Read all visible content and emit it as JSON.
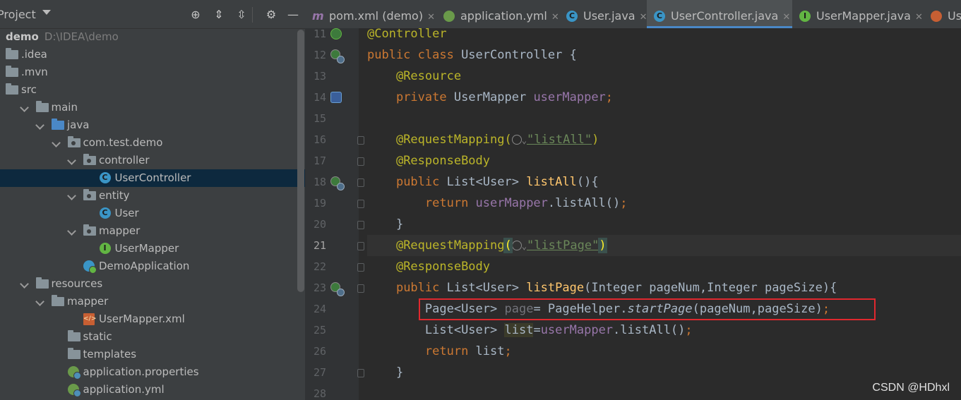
{
  "project_panel": {
    "title": "Project",
    "toolbar_icons": [
      "locate-icon",
      "expand-all-icon",
      "collapse-all-icon",
      "gear-icon",
      "minimize-icon"
    ],
    "tree": [
      {
        "label": "demo",
        "path": "D:\\IDEA\\demo",
        "indent": 0,
        "arrow": "none",
        "icon": "none",
        "bold": true
      },
      {
        "label": ".idea",
        "indent": 0,
        "arrow": "none",
        "icon": "folder"
      },
      {
        "label": ".mvn",
        "indent": 0,
        "arrow": "none",
        "icon": "folder"
      },
      {
        "label": "src",
        "indent": 0,
        "arrow": "none",
        "icon": "folder"
      },
      {
        "label": "main",
        "indent": 1,
        "arrow": "down",
        "icon": "folder"
      },
      {
        "label": "java",
        "indent": 2,
        "arrow": "down",
        "icon": "folder-blue"
      },
      {
        "label": "com.test.demo",
        "indent": 3,
        "arrow": "down",
        "icon": "package"
      },
      {
        "label": "controller",
        "indent": 4,
        "arrow": "down",
        "icon": "package"
      },
      {
        "label": "UserController",
        "indent": 5,
        "arrow": "none",
        "icon": "class",
        "selected": true
      },
      {
        "label": "entity",
        "indent": 4,
        "arrow": "down",
        "icon": "package"
      },
      {
        "label": "User",
        "indent": 5,
        "arrow": "none",
        "icon": "class"
      },
      {
        "label": "mapper",
        "indent": 4,
        "arrow": "down",
        "icon": "package"
      },
      {
        "label": "UserMapper",
        "indent": 5,
        "arrow": "none",
        "icon": "interface"
      },
      {
        "label": "DemoApplication",
        "indent": 4,
        "arrow": "none",
        "icon": "app"
      },
      {
        "label": "resources",
        "indent": 1,
        "arrow": "down",
        "icon": "folder"
      },
      {
        "label": "mapper",
        "indent": 2,
        "arrow": "down",
        "icon": "folder"
      },
      {
        "label": "UserMapper.xml",
        "indent": 4,
        "arrow": "none",
        "icon": "xml"
      },
      {
        "label": "static",
        "indent": 3,
        "arrow": "none",
        "icon": "folder"
      },
      {
        "label": "templates",
        "indent": 3,
        "arrow": "none",
        "icon": "folder"
      },
      {
        "label": "application.properties",
        "indent": 3,
        "arrow": "none",
        "icon": "spring"
      },
      {
        "label": "application.yml",
        "indent": 3,
        "arrow": "none",
        "icon": "spring"
      }
    ]
  },
  "tabs": [
    {
      "label": "pom.xml (demo)",
      "icon": "maven-icon",
      "closable": true
    },
    {
      "label": "application.yml",
      "icon": "spring-config-icon",
      "closable": true
    },
    {
      "label": "User.java",
      "icon": "class-icon",
      "closable": true
    },
    {
      "label": "UserController.java",
      "icon": "class-icon",
      "closable": true,
      "active": true
    },
    {
      "label": "UserMapper.java",
      "icon": "interface-icon",
      "closable": true
    },
    {
      "label": "Us",
      "icon": "xml-icon",
      "closable": false
    }
  ],
  "editor": {
    "current_line": 21,
    "lines": [
      {
        "num": "11",
        "gutter": "bean-green"
      },
      {
        "num": "12",
        "gutter": "bean-green-glob"
      },
      {
        "num": "13",
        "gutter": ""
      },
      {
        "num": "14",
        "gutter": "bean-blue"
      },
      {
        "num": "15",
        "gutter": ""
      },
      {
        "num": "16",
        "gutter": ""
      },
      {
        "num": "17",
        "gutter": ""
      },
      {
        "num": "18",
        "gutter": "bean-green-glob"
      },
      {
        "num": "19",
        "gutter": ""
      },
      {
        "num": "20",
        "gutter": ""
      },
      {
        "num": "21",
        "gutter": ""
      },
      {
        "num": "22",
        "gutter": ""
      },
      {
        "num": "23",
        "gutter": "bean-green-glob"
      },
      {
        "num": "24",
        "gutter": ""
      },
      {
        "num": "25",
        "gutter": ""
      },
      {
        "num": "26",
        "gutter": ""
      },
      {
        "num": "27",
        "gutter": ""
      },
      {
        "num": "28",
        "gutter": ""
      }
    ],
    "code": {
      "l11": "@Controller",
      "l12_kw": "public class",
      "l12_rest": " UserController {",
      "l13": "@Resource",
      "l14_kw": "private",
      "l14_type": " UserMapper ",
      "l14_field": "userMapper",
      "l14_semi": ";",
      "l16_ann": "@RequestMapping(",
      "l16_str": "\"listAll\"",
      "l16_close": ")",
      "l17": "@ResponseBody",
      "l18_kw": "public",
      "l18_type": " List<User> ",
      "l18_fn": "listAll",
      "l18_rest": "(){",
      "l19_kw": "return",
      "l19_field": " userMapper",
      "l19_rest": ".listAll()",
      "l19_semi": ";",
      "l20": "}",
      "l21_ann": "@RequestMapping",
      "l21_open": "(",
      "l21_str": "\"listPage\"",
      "l21_close": ")",
      "l22": "@ResponseBody",
      "l23_kw": "public",
      "l23_type": " List<User> ",
      "l23_fn": "listPage",
      "l23_rest": "(Integer pageNum,Integer pageSize){",
      "l24_type": "Page<User> ",
      "l24_var": "page",
      "l24_mid": "= PageHelper.",
      "l24_fn": "startPage",
      "l24_rest": "(pageNum,pageSize)",
      "l24_semi": ";",
      "l25_type": "List<User> ",
      "l25_var": "list",
      "l25_eq": "=",
      "l25_field": "userMapper",
      "l25_rest": ".listAll()",
      "l25_semi": ";",
      "l26_kw": "return",
      "l26_rest": " list",
      "l26_semi": ";",
      "l27": "}"
    },
    "highlight_box": {
      "line": 24,
      "color": "#e0282e"
    }
  },
  "watermark": "CSDN @HDhxl"
}
